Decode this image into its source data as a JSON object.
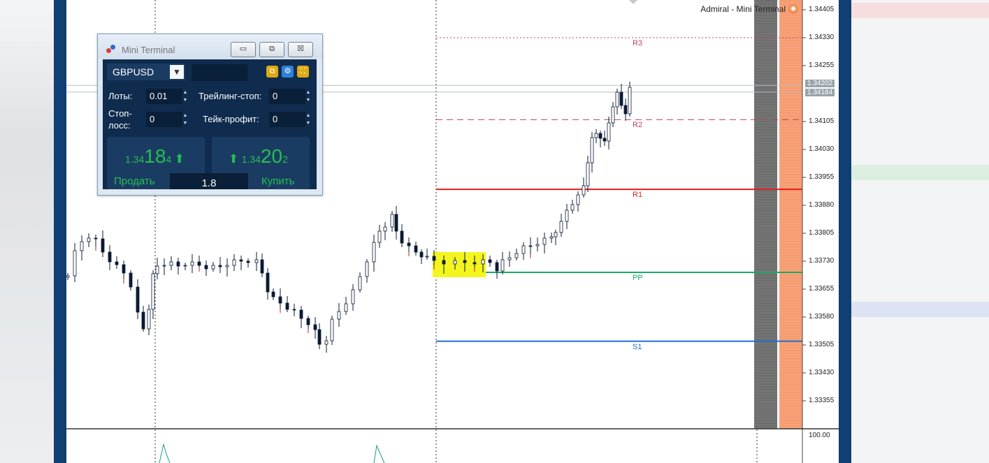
{
  "window_title": "Admiral - Mini Terminal",
  "price_axis": [
    {
      "price": 1.34405,
      "label": "1.34405"
    },
    {
      "price": 1.3433,
      "label": "1.34330"
    },
    {
      "price": 1.34255,
      "label": "1.34255"
    },
    {
      "price": 1.34105,
      "label": "1.34105"
    },
    {
      "price": 1.3403,
      "label": "1.34030"
    },
    {
      "price": 1.33955,
      "label": "1.33955"
    },
    {
      "price": 1.3388,
      "label": "1.33880"
    },
    {
      "price": 1.33805,
      "label": "1.33805"
    },
    {
      "price": 1.3373,
      "label": "1.33730"
    },
    {
      "price": 1.33655,
      "label": "1.33655"
    },
    {
      "price": 1.3358,
      "label": "1.33580"
    },
    {
      "price": 1.33505,
      "label": "1.33505"
    },
    {
      "price": 1.3343,
      "label": "1.33430"
    },
    {
      "price": 1.33355,
      "label": "1.33355"
    }
  ],
  "price_tags": [
    {
      "price": 1.34202,
      "label": "1.34202"
    },
    {
      "price": 1.34184,
      "label": "1.34184"
    }
  ],
  "pivots": [
    {
      "name": "R3",
      "price": 1.3433,
      "color": "#c0405a",
      "style": "dotted"
    },
    {
      "name": "R2",
      "price": 1.3411,
      "color": "#c0405a",
      "style": "dashed"
    },
    {
      "name": "R1",
      "price": 1.33923,
      "color": "#e21d1d",
      "style": "solid"
    },
    {
      "name": "PP",
      "price": 1.337,
      "color": "#1aa866",
      "style": "solid"
    },
    {
      "name": "S1",
      "price": 1.33515,
      "color": "#1f6fd1",
      "style": "solid"
    }
  ],
  "subwindow_label": "100.00",
  "colors": {
    "frame": "#0f3f73",
    "bull": "#0b1a33",
    "bear": "#c8202a",
    "highlight": "#f5f51e",
    "depth_gray": "#6e6e6e",
    "depth_orange": "#f79b70"
  },
  "mini_terminal": {
    "title": "Mini Terminal",
    "buttons": {
      "minimize": "▭",
      "restore": "⧉",
      "close": "☒"
    },
    "symbol": "GBPUSD",
    "icons": [
      "copy-icon",
      "settings-icon",
      "expand-icon"
    ],
    "lots_label": "Лоты:",
    "lots_value": "0.01",
    "trailing_label": "Трейлинг-стоп:",
    "trailing_value": "0",
    "stoploss_label_1": "Стоп-",
    "stoploss_label_2": "лосс:",
    "stoploss_value": "0",
    "takeprofit_label": "Тейк-профит:",
    "takeprofit_value": "0",
    "sell": {
      "prefix": "1.34",
      "big": "18",
      "small": "4",
      "label": "Продать"
    },
    "buy": {
      "prefix": "1.34",
      "big": "20",
      "small": "2",
      "label": "Купить"
    },
    "spread": "1.8"
  }
}
